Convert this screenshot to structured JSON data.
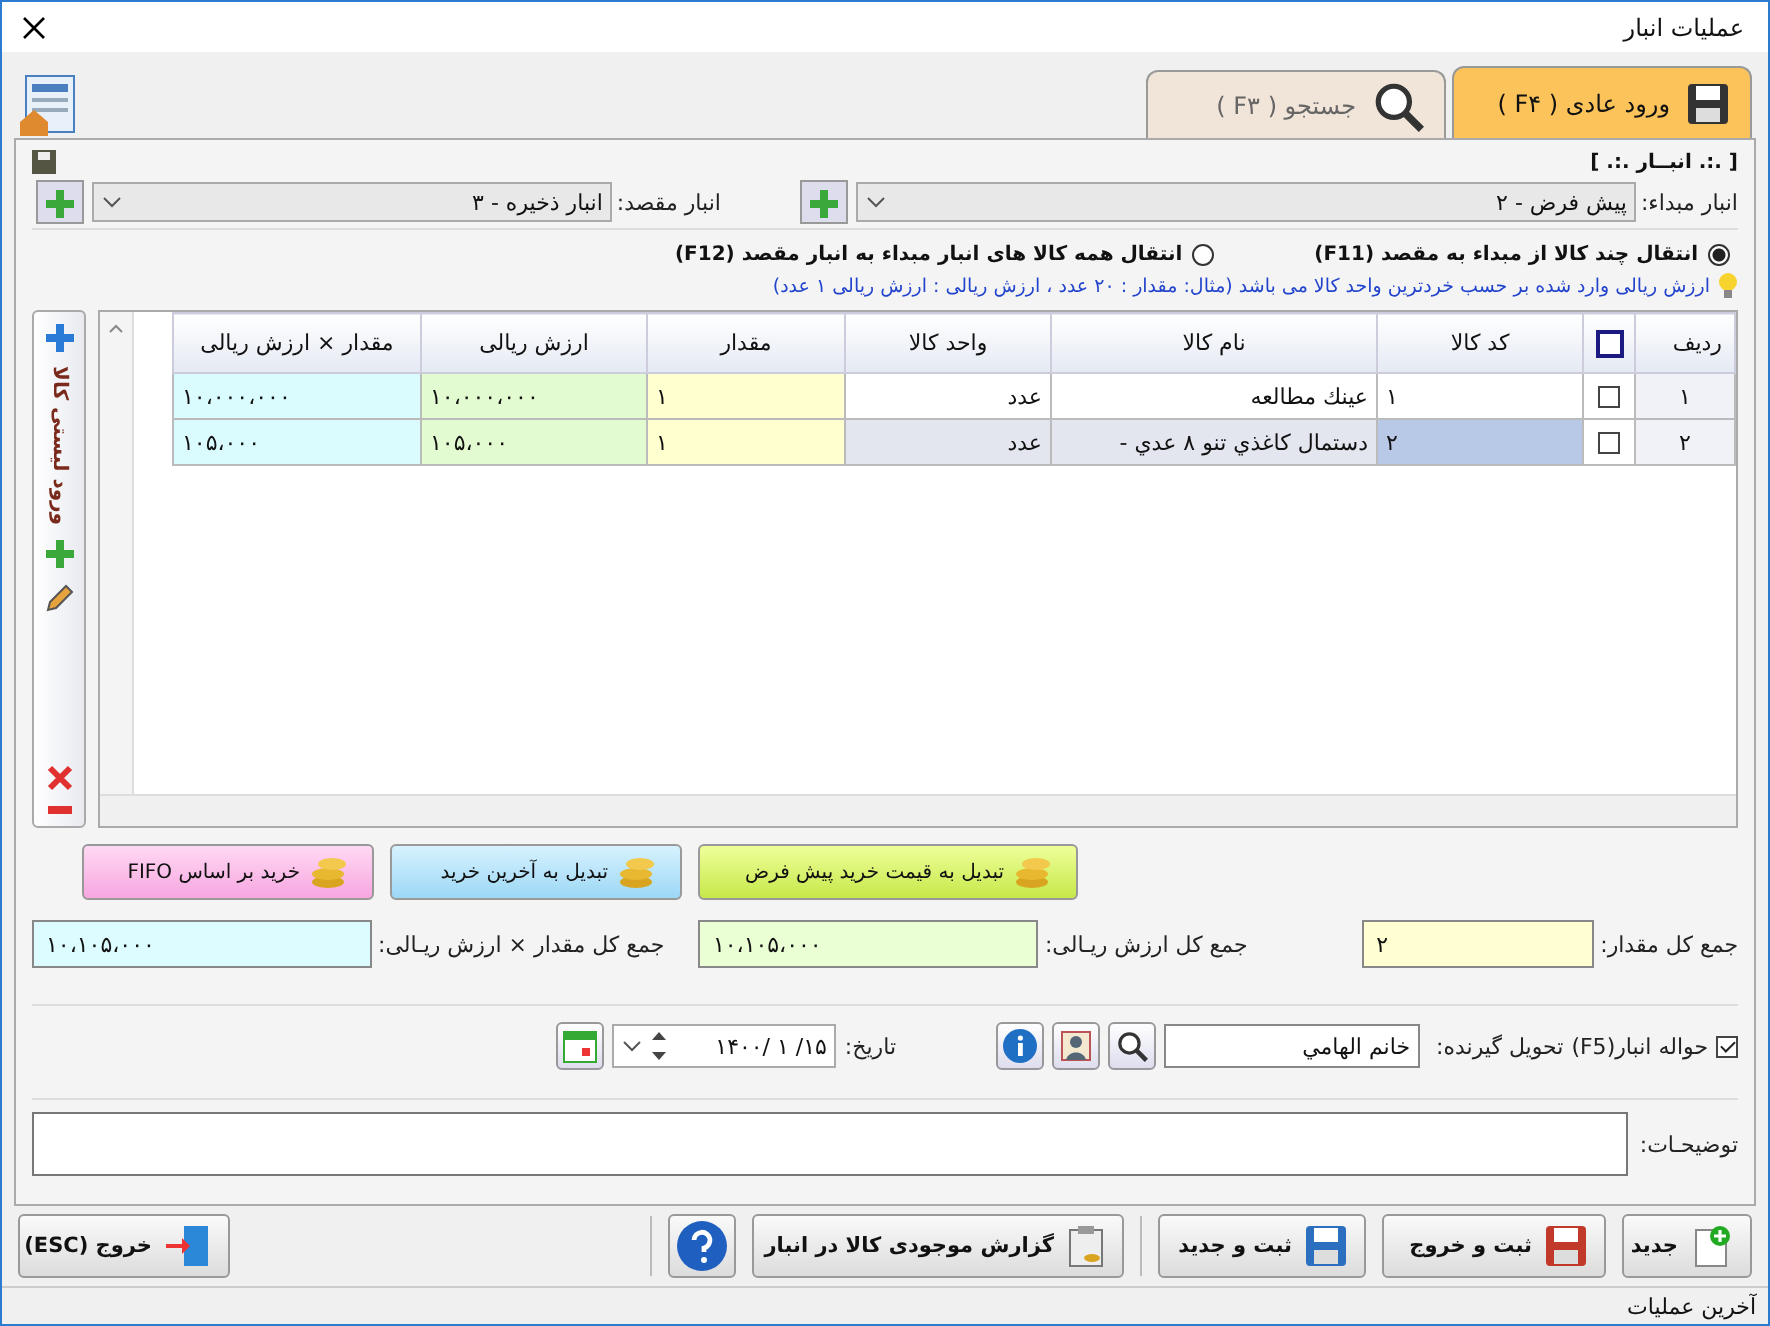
{
  "window": {
    "title": "عملیات انبار"
  },
  "tabs": [
    {
      "label": "ورود عادی ( F۴ )",
      "selected": true,
      "kind": "save"
    },
    {
      "label": "جستجو ( F۳ )",
      "selected": false,
      "kind": "search"
    }
  ],
  "warehouse": {
    "heading": "[ .:. انبــار .:. ]",
    "source": {
      "label": "انبار مبداء:",
      "value": "پیش فرض - ۲"
    },
    "destination": {
      "label": "انبار مقصد:",
      "value": "انبار ذخیره - ۳"
    }
  },
  "transfer_modes": [
    {
      "label": "انتقال چند کالا از مبداء به مقصد (F11)",
      "selected": true
    },
    {
      "label": "انتقال همه کالا های انبار مبداء به انبار مقصد (F12)",
      "selected": false
    }
  ],
  "hint": "ارزش ریالی  وارد شده بر حسب خردترین واحد کالا می باشد (مثال:  مقدار : ۲۰ عدد  ،  ارزش ریالی : ارزش ریالی ۱ عدد)",
  "side_toolbar": {
    "label": "ورود لیستی کالا"
  },
  "table": {
    "select_all_checked": false,
    "columns": [
      "ردیف",
      "کد کالا",
      "نام کالا",
      "واحد کالا",
      "مقدار",
      "ارزش ریالی",
      "مقدار × ارزش ریالی"
    ],
    "rows": [
      {
        "checked": false,
        "selected": false,
        "cells": [
          "۱",
          "۱",
          "عینك مطالعه",
          "عدد",
          "۱",
          "۱۰،۰۰۰،۰۰۰",
          "۱۰،۰۰۰،۰۰۰"
        ]
      },
      {
        "checked": false,
        "selected": true,
        "cells": [
          "۲",
          "۲",
          "دستمال كاغذي تنو ۸ عدي -",
          "عدد",
          "۱",
          "۱۰۵،۰۰۰",
          "۱۰۵،۰۰۰"
        ]
      }
    ]
  },
  "pricing_buttons": [
    {
      "label": "تبدیل به قیمت خرید پیش فرض",
      "kind": "default"
    },
    {
      "label": "تبدیل به آخرین خرید",
      "kind": "last"
    },
    {
      "label": "خرید بر اساس FIFO",
      "kind": "fifo"
    }
  ],
  "totals": [
    {
      "label": "جمع کل مقدار:",
      "value": "۲"
    },
    {
      "label": "جمع کل ارزش ریـالی:",
      "value": "۱۰،۱۰۵،۰۰۰"
    },
    {
      "label": "جمع کل مقدار × ارزش ریـالی:",
      "value": "۱۰،۱۰۵،۰۰۰"
    }
  ],
  "receipt": {
    "checked": true,
    "label": "حواله انبار(F5)",
    "receiver_label": "تحویل گیرنده:",
    "receiver": "خانم الهامي"
  },
  "date": {
    "label": "تاریخ:",
    "value": "۱۴۰۰/ ۱ /۱۵"
  },
  "notes": {
    "label": "توضیحـات:"
  },
  "footer_buttons": [
    {
      "label": "جدید",
      "kind": "new"
    },
    {
      "label": "ثبت و خروج",
      "kind": "save-exit"
    },
    {
      "label": "ثبت و جدید",
      "kind": "save-new"
    },
    {
      "label": "گزارش موجودی کالا در انبار",
      "kind": "report"
    },
    {
      "kind": "help"
    },
    {
      "label": "خروج (ESC)",
      "kind": "exit"
    }
  ],
  "status_bar": "آخرین عملیات"
}
